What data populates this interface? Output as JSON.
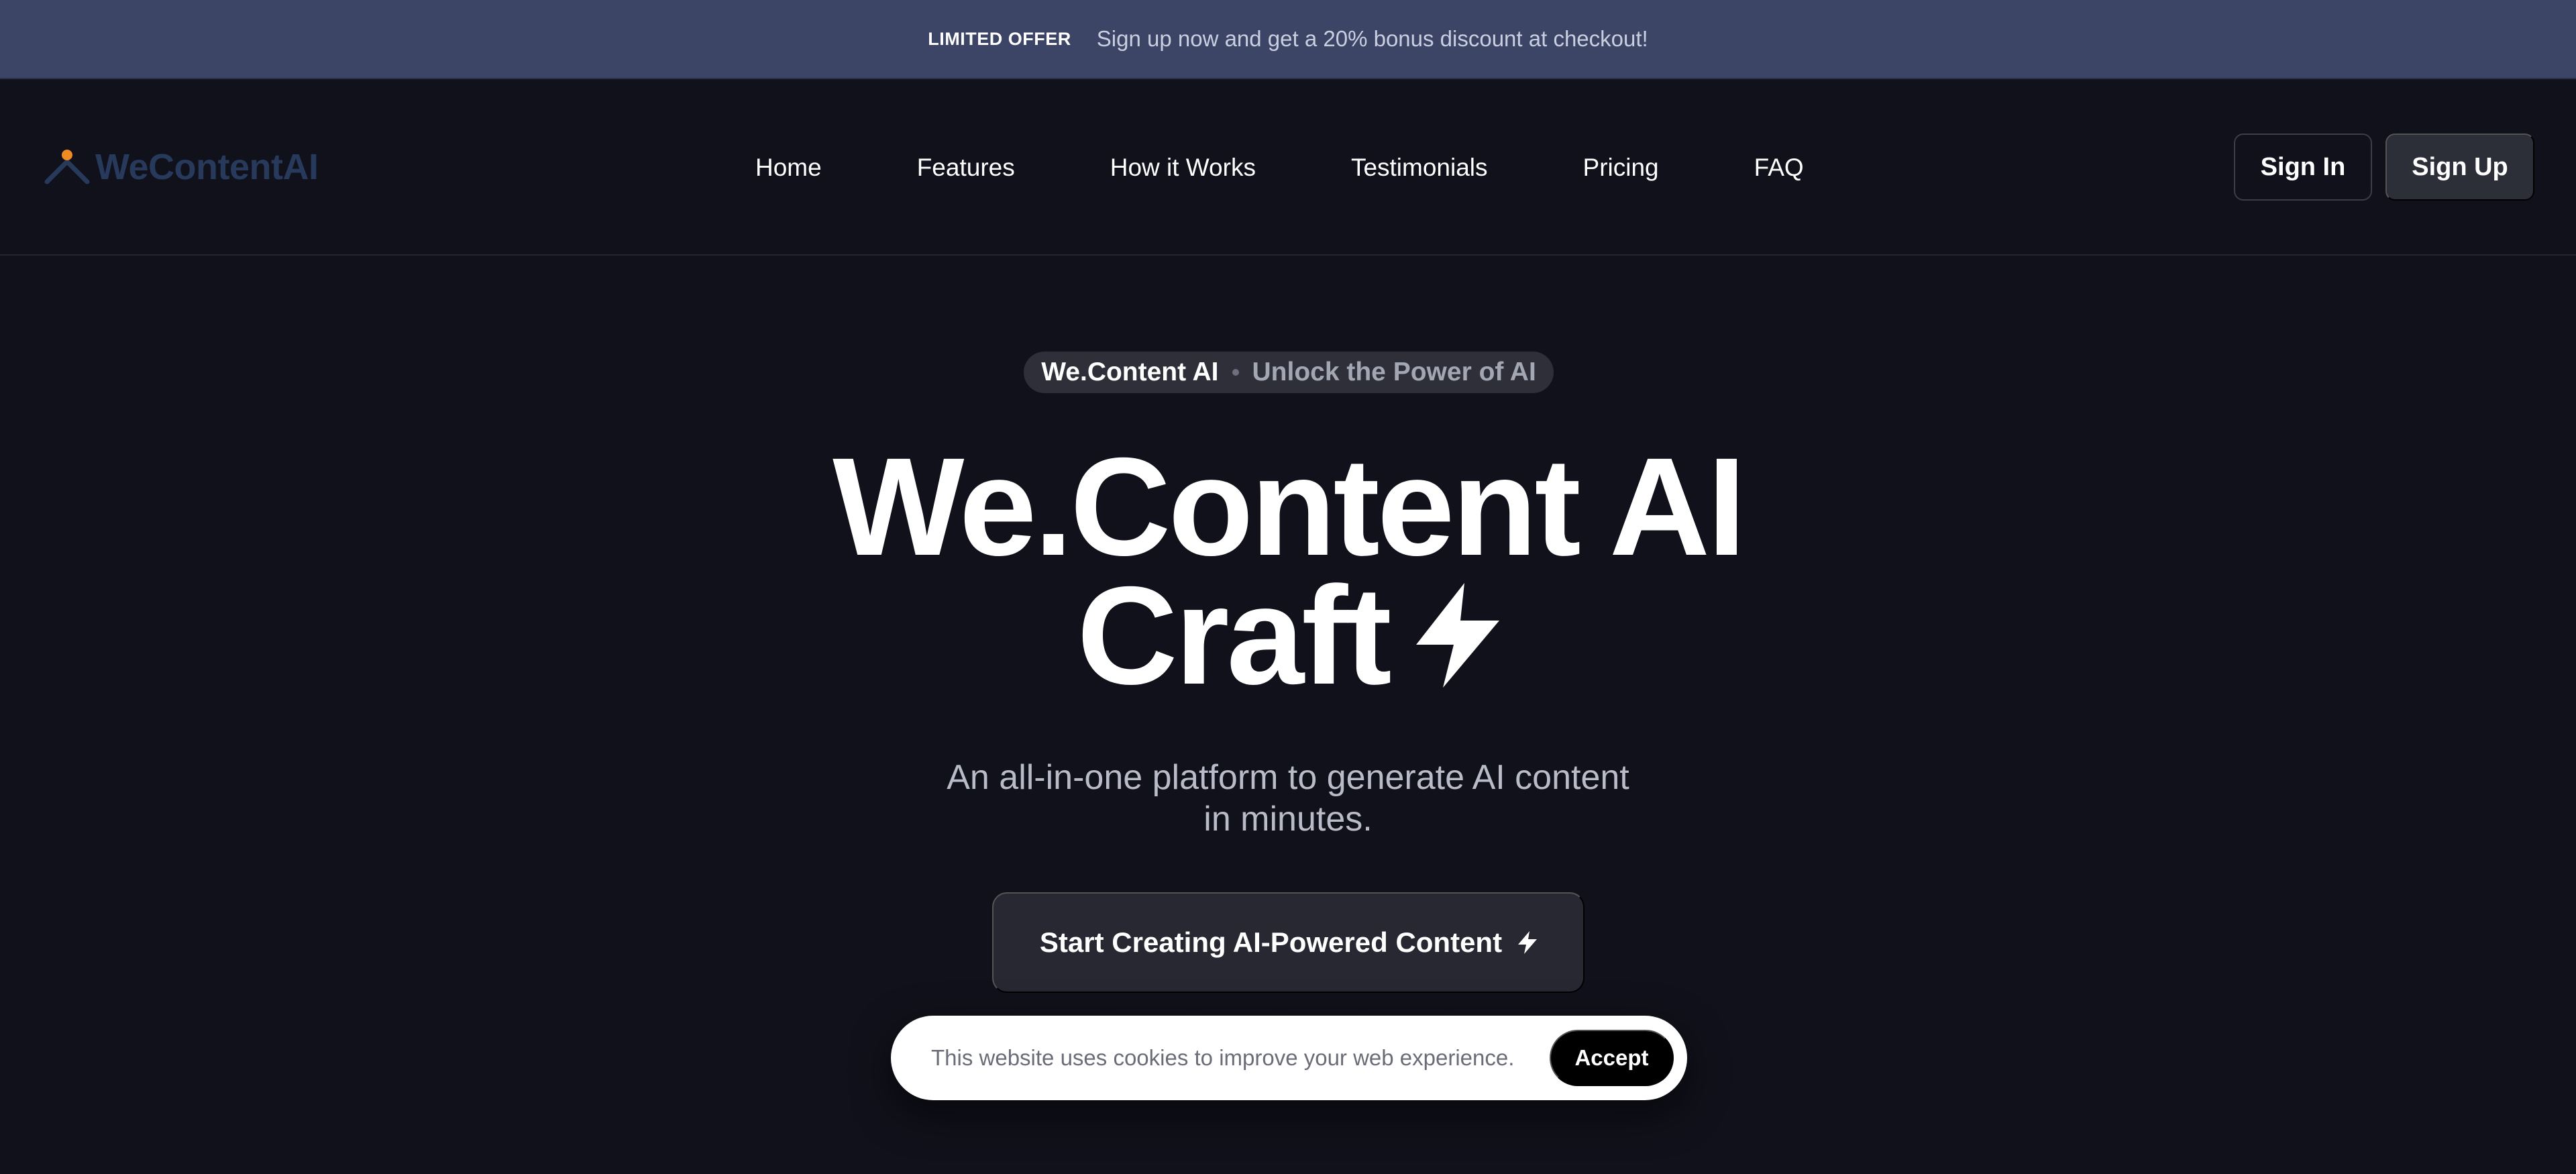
{
  "promo": {
    "tag": "LIMITED OFFER",
    "text": "Sign up now and get a 20% bonus discount at checkout!"
  },
  "nav": {
    "logo_text": "WeContentAI",
    "links": [
      "Home",
      "Features",
      "How it Works",
      "Testimonials",
      "Pricing",
      "FAQ"
    ],
    "sign_in": "Sign In",
    "sign_up": "Sign Up"
  },
  "hero": {
    "pill_primary": "We.Content AI",
    "pill_secondary": "Unlock the Power of AI",
    "title_line1": "We.Content AI",
    "title_line2": "Craft",
    "subtitle": "An all-in-one platform to generate AI content in minutes.",
    "cta_label": "Start Creating AI-Powered Content"
  },
  "cookie": {
    "text": "This website uses cookies to improve your web experience.",
    "accept": "Accept"
  },
  "colors": {
    "background": "#10111a",
    "promo_bar": "#3c4566",
    "logo_blue": "#273a5c",
    "logo_orange": "#f08a24"
  },
  "icons": {
    "logo": "mountain-peak-icon",
    "title_bolt": "lightning-bolt-icon",
    "cta_bolt": "lightning-bolt-icon"
  }
}
